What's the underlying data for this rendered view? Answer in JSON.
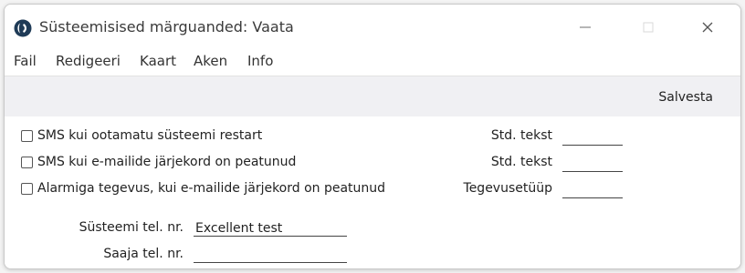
{
  "window": {
    "title": "Süsteemisised märguanded: Vaata"
  },
  "menubar": {
    "items": [
      "Fail",
      "Redigeeri",
      "Kaart",
      "Aken",
      "Info"
    ]
  },
  "toolbar": {
    "save_label": "Salvesta"
  },
  "options": [
    {
      "label": "SMS kui ootamatu süsteemi restart",
      "checked": false,
      "right_label": "Std. tekst",
      "right_value": ""
    },
    {
      "label": "SMS kui e-mailide järjekord on peatunud",
      "checked": false,
      "right_label": "Std. tekst",
      "right_value": ""
    },
    {
      "label": "Alarmiga tegevus, kui e-mailide järjekord on peatunud",
      "checked": false,
      "right_label": "Tegevusetüüp",
      "right_value": ""
    }
  ],
  "phones": {
    "system_label": "Süsteemi tel. nr.",
    "system_value": "Excellent test",
    "recipient_label": "Saaja tel. nr.",
    "recipient_value": ""
  },
  "colors": {
    "icon_blue": "#1f3b57",
    "toolbar_bg": "#f0f0f3"
  }
}
